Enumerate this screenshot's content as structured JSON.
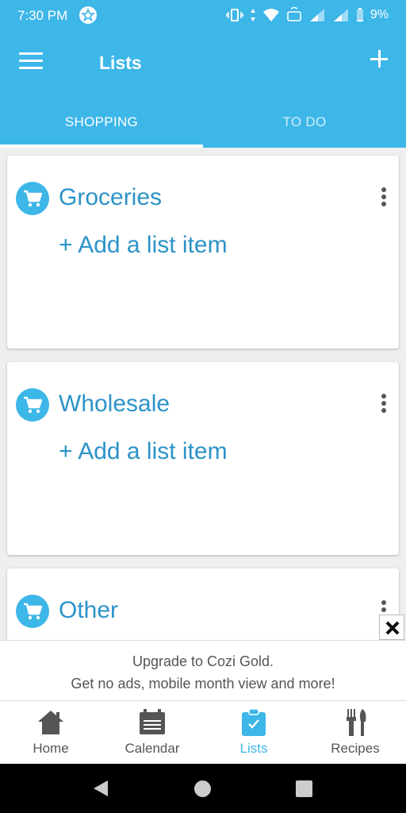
{
  "status_bar": {
    "time": "7:30 PM",
    "battery": "9%"
  },
  "app_bar": {
    "title": "Lists"
  },
  "tabs": [
    {
      "label": "SHOPPING",
      "active": true
    },
    {
      "label": "TO DO",
      "active": false
    }
  ],
  "lists": [
    {
      "title": "Groceries",
      "add_item_label": "+ Add a list item"
    },
    {
      "title": "Wholesale",
      "add_item_label": "+ Add a list item"
    },
    {
      "title": "Other"
    }
  ],
  "promo": {
    "line1": "Upgrade to Cozi Gold.",
    "line2": "Get no ads, mobile month view and more!"
  },
  "bottom_nav": [
    {
      "label": "Home",
      "icon": "home-icon",
      "active": false
    },
    {
      "label": "Calendar",
      "icon": "calendar-icon",
      "active": false
    },
    {
      "label": "Lists",
      "icon": "clipboard-check-icon",
      "active": true
    },
    {
      "label": "Recipes",
      "icon": "fork-knife-icon",
      "active": false
    }
  ],
  "colors": {
    "accent": "#3db6e8",
    "link": "#2c93c8",
    "inactive": "#555555"
  }
}
